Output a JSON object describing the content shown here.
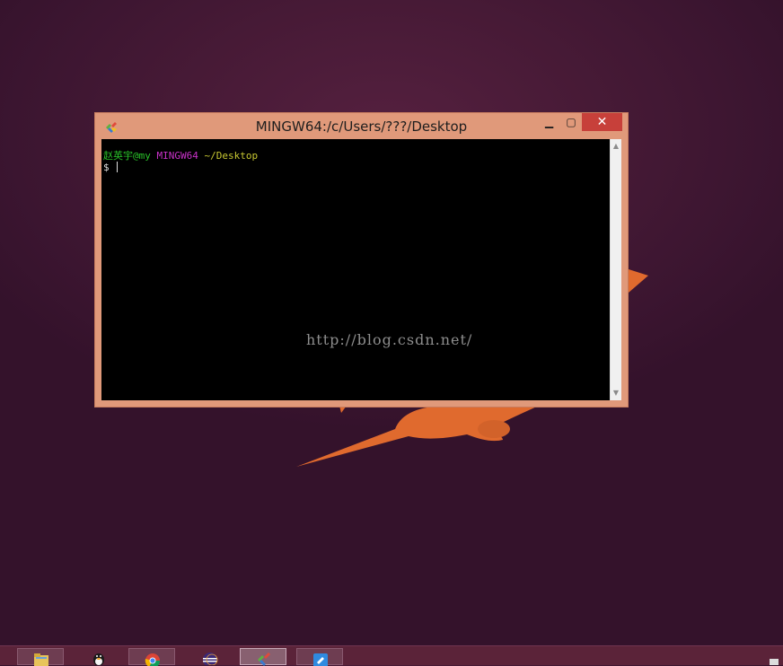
{
  "window": {
    "title": "MINGW64:/c/Users/???/Desktop",
    "controls": {
      "minimize": "▁",
      "maximize": "▢",
      "close": "✕"
    }
  },
  "terminal": {
    "prompt_user": "赵英宇@my",
    "prompt_system": "MINGW64",
    "prompt_path": "~/Desktop",
    "prompt_symbol": "$",
    "watermark": "http://blog.csdn.net/"
  },
  "taskbar": {
    "items": [
      {
        "name": "file-explorer",
        "icon": "folder-icon"
      },
      {
        "name": "qq",
        "icon": "penguin-icon"
      },
      {
        "name": "chrome",
        "icon": "chrome-icon"
      },
      {
        "name": "eclipse",
        "icon": "eclipse-icon"
      },
      {
        "name": "git-bash",
        "icon": "git-icon",
        "active": true
      },
      {
        "name": "app",
        "icon": "blue-app-icon"
      }
    ]
  },
  "colors": {
    "window_frame": "#e0997a",
    "close_button": "#c7403a",
    "prompt_user": "#29c329",
    "prompt_system": "#c832c8",
    "prompt_path": "#c8c832",
    "wallpaper_shape": "#e06a2e"
  }
}
